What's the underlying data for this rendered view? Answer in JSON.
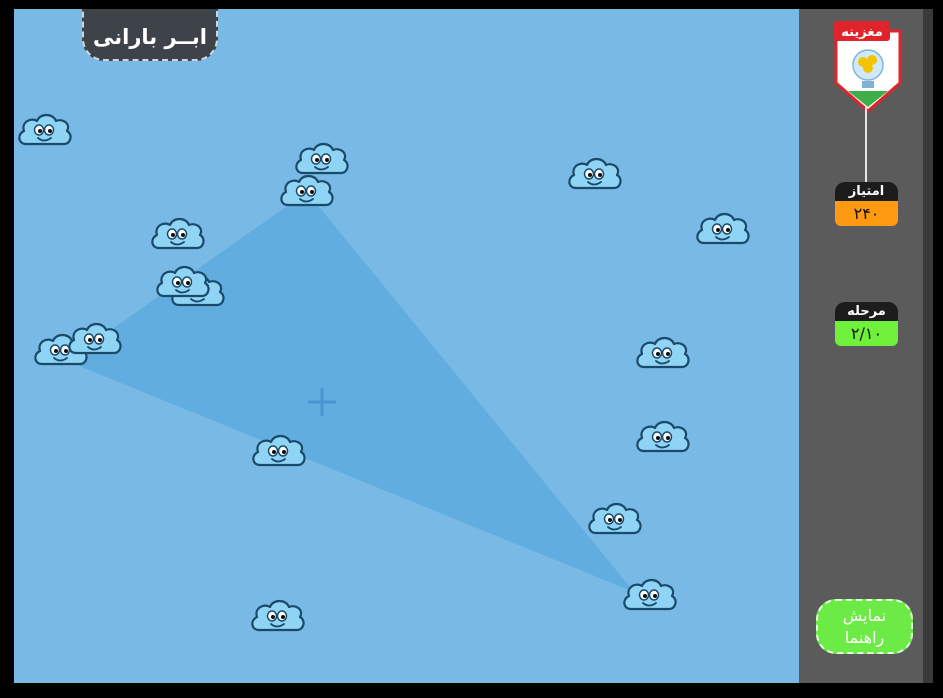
{
  "game": {
    "title": "ابــر بارانی",
    "brand": "مغزینه",
    "score_label": "امتیاز",
    "score_value": "۲۴۰",
    "level_label": "مرحله",
    "level_value": "۲/۱۰",
    "hint_line1": "نمایش",
    "hint_line2": "راهنما"
  },
  "colors": {
    "sky": "#78b9e5",
    "triangle_fill": "#5aa9dd",
    "cloud_fill": "#8fd3f5",
    "cloud_outline": "#1a4a6a",
    "panel": "#5b5b5b",
    "score_accent": "#ff9a12",
    "level_accent": "#6ff03a",
    "hint_button": "#6ceb47",
    "logo_red": "#e1232c"
  },
  "icons": {
    "cloud": "smiling-cloud-icon",
    "crosshair": "plus-crosshair-icon",
    "logo": "lightbulb-brain-logo"
  }
}
